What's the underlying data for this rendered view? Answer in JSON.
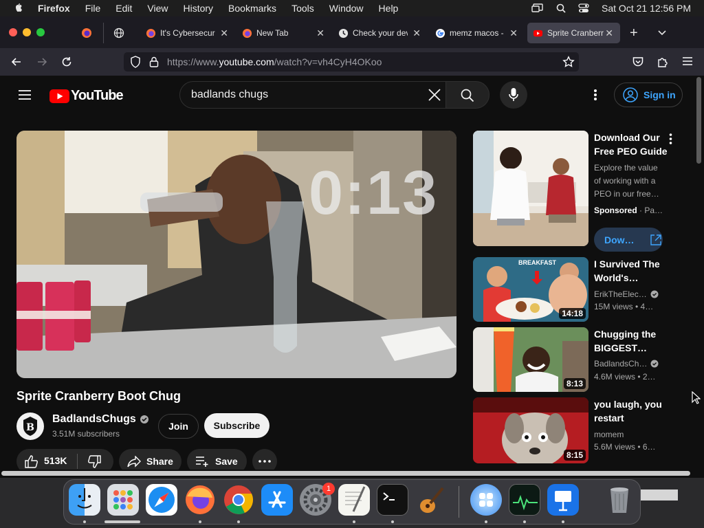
{
  "menubar": {
    "app": "Firefox",
    "items": [
      "File",
      "Edit",
      "View",
      "History",
      "Bookmarks",
      "Tools",
      "Window",
      "Help"
    ],
    "datetime": "Sat Oct 21  12:56 PM"
  },
  "tabs": [
    {
      "title": "It's Cybersecur"
    },
    {
      "title": "New Tab"
    },
    {
      "title": "Check your dev"
    },
    {
      "title": "memz macos -"
    },
    {
      "title": "Sprite Cranberr"
    }
  ],
  "url": {
    "prefix": "https://www.",
    "host": "youtube.com",
    "path": "/watch?v=vh4CyH4OKoo"
  },
  "youtube": {
    "logo": "YouTube",
    "search_value": "badlands chugs",
    "sign_in": "Sign in",
    "timer": "0:13",
    "video_title": "Sprite Cranberry Boot Chug",
    "channel": "BadlandsChugs",
    "subscribers": "3.51M subscribers",
    "join": "Join",
    "subscribe": "Subscribe",
    "likes": "513K",
    "share": "Share",
    "save": "Save"
  },
  "sidebar": {
    "ad": {
      "title1": "Download Our",
      "title2": "Free PEO Guide",
      "desc1": "Explore the value",
      "desc2": "of working with a",
      "desc3": "PEO in our free…",
      "sponsored": "Sponsored",
      "advertiser": " · Pa…",
      "button": "Dow…"
    },
    "videos": [
      {
        "title1": "I Survived The",
        "title2": "World's…",
        "channel": "ErikTheElec…",
        "meta": "15M views  •  4…",
        "duration": "14:18",
        "thumb_text": "BREAKFAST"
      },
      {
        "title1": "Chugging the",
        "title2": "BIGGEST…",
        "channel": "BadlandsCh…",
        "meta": "4.6M views  •  2…",
        "duration": "8:13"
      },
      {
        "title1": "you laugh, you",
        "title2": "restart",
        "channel": "momem",
        "meta": "5.6M views  •  6…",
        "duration": "8:15"
      }
    ]
  },
  "dock": {
    "badge": "1"
  }
}
